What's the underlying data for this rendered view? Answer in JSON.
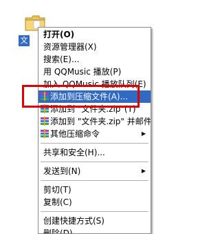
{
  "desktop": {
    "folder_label": "文",
    "folder_icon": "folder-icon"
  },
  "menu": {
    "items": [
      {
        "label": "打开(O)"
      },
      {
        "label": "资源管理器(X)"
      },
      {
        "label": "搜索(E)..."
      },
      {
        "label": "用 QQMusic 播放(P)"
      },
      {
        "label": "加入 QQMusic 播放队列(E)"
      },
      {
        "label": "添加到压缩文件(A)..."
      },
      {
        "label": "添加到 \"文件夹.zip\"(T)"
      },
      {
        "label": "添加到 \"文件夹.zip\" 并邮件"
      },
      {
        "label": "其他压缩命令"
      },
      {
        "label": "共享和安全(H)..."
      },
      {
        "label": "发送到(N)"
      },
      {
        "label": "剪切(T)"
      },
      {
        "label": "复制(C)"
      },
      {
        "label": "创建快捷方式(S)"
      },
      {
        "label": "删除(D)"
      }
    ],
    "submenu_arrow": "▶",
    "icon": "winrar-archive-icon"
  },
  "colors": {
    "highlight": "#316ac5",
    "annotation_box": "#e00000"
  }
}
